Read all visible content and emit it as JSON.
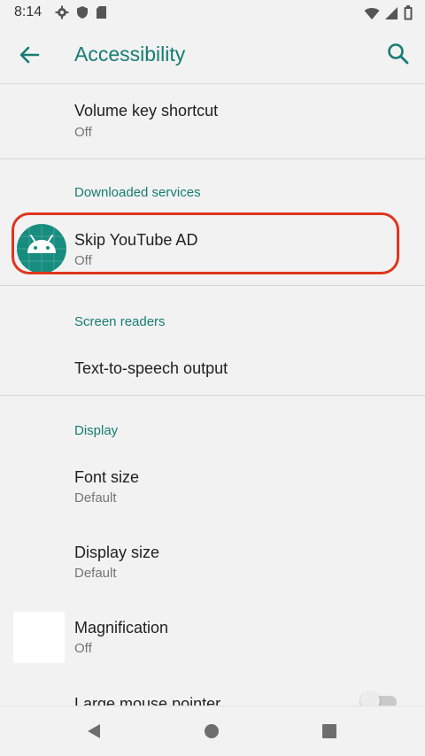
{
  "status_bar": {
    "time": "8:14",
    "left_icons": [
      "gear-icon",
      "shield-icon",
      "sd-card-icon"
    ],
    "right_icons": [
      "wifi-icon",
      "cell-signal-icon",
      "battery-icon"
    ]
  },
  "app_bar": {
    "title": "Accessibility",
    "back_icon": "arrow-left-icon",
    "search_icon": "search-icon"
  },
  "accent_color": "#167d74",
  "highlight_color": "#e0351d",
  "items": {
    "volume_key": {
      "title": "Volume key shortcut",
      "subtitle": "Off"
    },
    "downloaded_header": "Downloaded services",
    "skip_ad": {
      "title": "Skip YouTube AD",
      "subtitle": "Off",
      "icon": "android-robot-icon"
    },
    "screen_readers_header": "Screen readers",
    "tts": {
      "title": "Text-to-speech output"
    },
    "display_header": "Display",
    "font_size": {
      "title": "Font size",
      "subtitle": "Default"
    },
    "display_size": {
      "title": "Display size",
      "subtitle": "Default"
    },
    "magnification": {
      "title": "Magnification",
      "subtitle": "Off"
    },
    "large_pointer": {
      "title": "Large mouse pointer",
      "toggle": "off"
    }
  },
  "nav_bar": {
    "back": "triangle-back-icon",
    "home": "circle-home-icon",
    "recents": "square-recents-icon"
  }
}
